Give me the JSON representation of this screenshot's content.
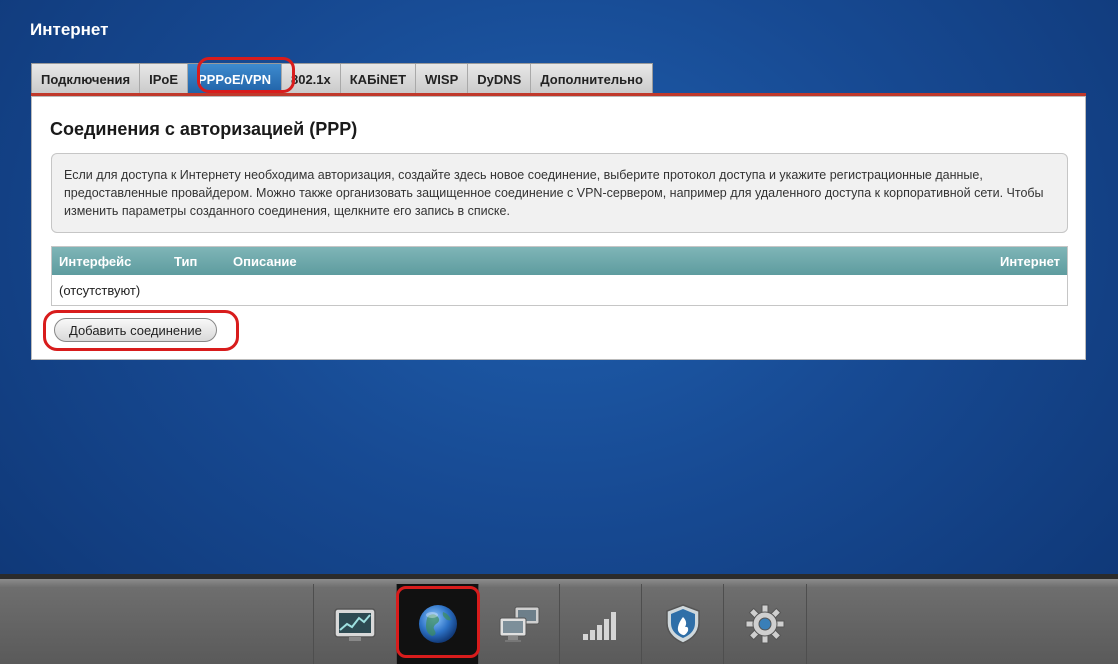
{
  "page_title": "Интернет",
  "tabs": [
    {
      "label": "Подключения",
      "active": false
    },
    {
      "label": "IPoE",
      "active": false
    },
    {
      "label": "PPPoE/VPN",
      "active": true
    },
    {
      "label": "802.1x",
      "active": false
    },
    {
      "label": "КАБiNET",
      "active": false
    },
    {
      "label": "WISP",
      "active": false
    },
    {
      "label": "DyDNS",
      "active": false
    },
    {
      "label": "Дополнительно",
      "active": false
    }
  ],
  "panel": {
    "title": "Соединения с авторизацией (PPP)",
    "info": "Если для доступа к Интернету необходима авторизация, создайте здесь новое соединение, выберите протокол доступа и укажите регистрационные данные, предоставленные провайдером. Можно также организовать защищенное соединение с VPN-сервером, например для удаленного доступа к корпоративной сети. Чтобы изменить параметры созданного соединения, щелкните его запись в списке.",
    "table": {
      "columns": [
        "Интерфейс",
        "Тип",
        "Описание",
        "Интернет"
      ],
      "empty_text": "(отсутствуют)"
    },
    "add_button": "Добавить соединение"
  },
  "taskbar": {
    "items": [
      {
        "icon": "monitor-chart-icon",
        "active": false
      },
      {
        "icon": "globe-icon",
        "active": true
      },
      {
        "icon": "network-computers-icon",
        "active": false
      },
      {
        "icon": "signal-bars-icon",
        "active": false
      },
      {
        "icon": "shield-icon",
        "active": false
      },
      {
        "icon": "gear-icon",
        "active": false
      }
    ]
  },
  "colors": {
    "highlight": "#d81c1c",
    "active_tab": "#2f76bd",
    "table_header": "#6fa9ab"
  }
}
